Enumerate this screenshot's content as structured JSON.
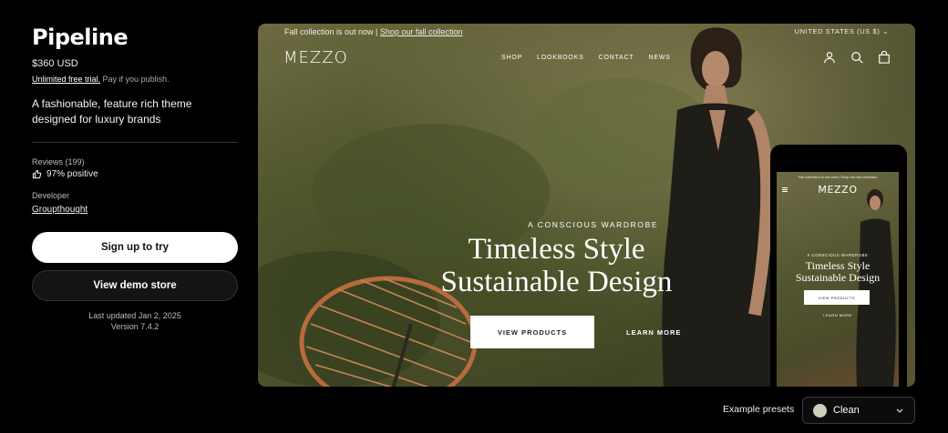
{
  "app": {
    "title": "Pipeline",
    "price": "$360 USD",
    "trial_link": "Unlimited free trial.",
    "trial_note": "Pay if you publish.",
    "description": "A fashionable, feature rich theme designed for luxury brands",
    "reviews_label": "Reviews (199)",
    "reviews_value": "97% positive",
    "developer_label": "Developer",
    "developer_name": "Groupthought",
    "primary_button": "Sign up to try",
    "secondary_button": "View demo store",
    "last_updated": "Last updated Jan 2, 2025",
    "version": "Version 7.4.2"
  },
  "preview": {
    "announcement_text": "Fall collection is out now |",
    "announcement_link": "Shop our fall collection",
    "region": "UNITED STATES (US $)",
    "logo": "MEZZO",
    "nav": [
      "SHOP",
      "LOOKBOOKS",
      "CONTACT",
      "NEWS"
    ],
    "icons": [
      "account-icon",
      "search-icon",
      "bag-icon"
    ],
    "eyebrow": "A CONSCIOUS WARDROBE",
    "hero_line1": "Timeless Style",
    "hero_line2": "Sustainable Design",
    "cta": "VIEW PRODUCTS",
    "secondary_cta": "LEARN MORE"
  },
  "mobile": {
    "announcement": "Fall collection is out now | Shop our fall collection",
    "logo": "MEZZO",
    "eyebrow": "A CONSCIOUS WARDROBE",
    "hero_line1": "Timeless Style",
    "hero_line2": "Sustainable Design",
    "cta": "VIEW PRODUCTS",
    "secondary_cta": "LEARN MORE"
  },
  "presets": {
    "label": "Example presets",
    "selected": "Clean",
    "swatch_color": "#c9d1b9"
  }
}
